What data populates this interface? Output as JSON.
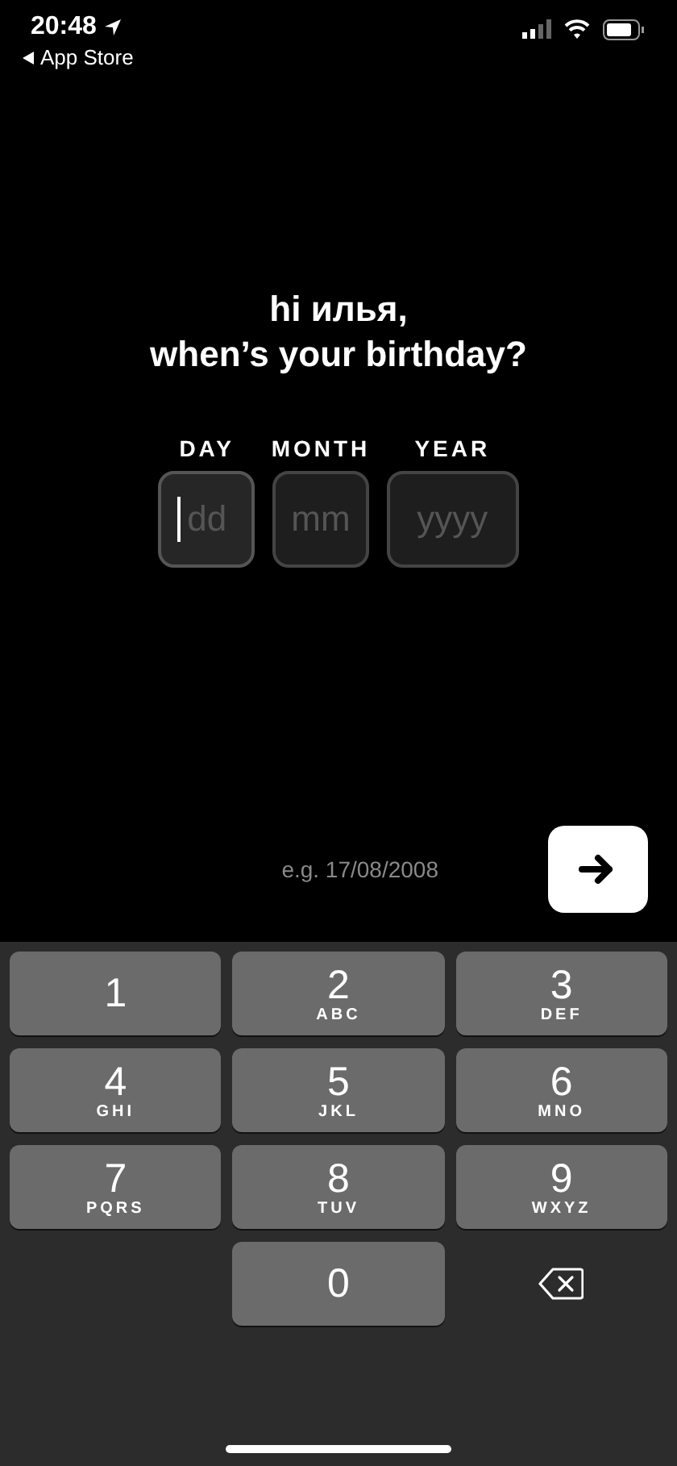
{
  "status_bar": {
    "time": "20:48",
    "back_link": "App Store"
  },
  "greeting": {
    "line_1": "hi илья,",
    "line_2": "when’s your birthday?"
  },
  "fields": [
    {
      "label": "DAY",
      "placeholder": "dd",
      "focused": true
    },
    {
      "label": "MONTH",
      "placeholder": "mm",
      "focused": false
    },
    {
      "label": "YEAR",
      "placeholder": "yyyy",
      "focused": false
    }
  ],
  "hint": "e.g. 17/08/2008",
  "keypad": [
    {
      "kind": "digit",
      "digit": "1"
    },
    {
      "kind": "digit",
      "digit": "2",
      "letters": "ABC"
    },
    {
      "kind": "digit",
      "digit": "3",
      "letters": "DEF"
    },
    {
      "kind": "digit",
      "digit": "4",
      "letters": "GHI"
    },
    {
      "kind": "digit",
      "digit": "5",
      "letters": "JKL"
    },
    {
      "kind": "digit",
      "digit": "6",
      "letters": "MNO"
    },
    {
      "kind": "digit",
      "digit": "7",
      "letters": "PQRS"
    },
    {
      "kind": "digit",
      "digit": "8",
      "letters": "TUV"
    },
    {
      "kind": "digit",
      "digit": "9",
      "letters": "WXYZ"
    },
    {
      "kind": "blank"
    },
    {
      "kind": "digit",
      "digit": "0"
    },
    {
      "kind": "delete"
    }
  ]
}
